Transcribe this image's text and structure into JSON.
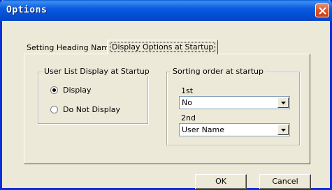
{
  "window": {
    "title": "Options"
  },
  "tabs": [
    {
      "label": "Setting Heading Names",
      "active": false
    },
    {
      "label": "Display Options at Startup",
      "active": true
    }
  ],
  "user_list_group": {
    "title": "User List Display at Startup",
    "options": [
      {
        "label": "Display",
        "checked": true
      },
      {
        "label": "Do Not Display",
        "checked": false
      }
    ]
  },
  "sorting_group": {
    "title": "Sorting order at startup",
    "first": {
      "label": "1st",
      "value": "No"
    },
    "second": {
      "label": "2nd",
      "value": "User Name"
    }
  },
  "buttons": {
    "ok": "OK",
    "cancel": "Cancel"
  }
}
